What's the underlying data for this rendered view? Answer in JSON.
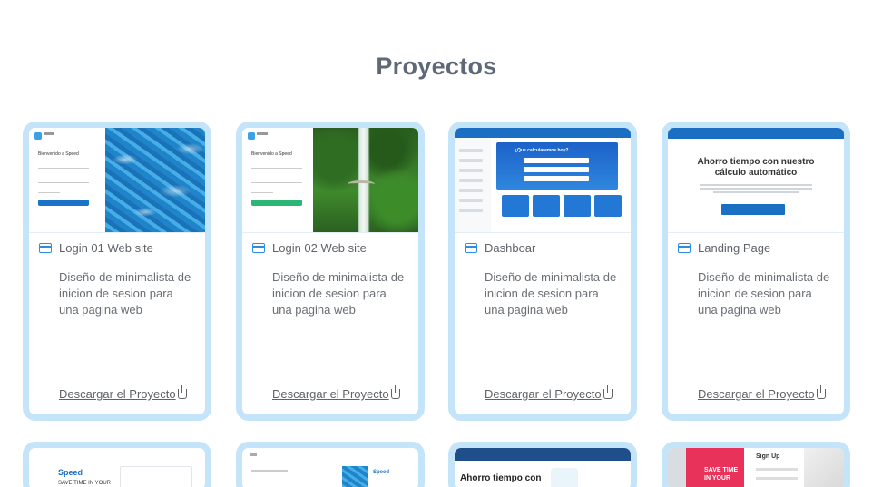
{
  "page": {
    "title": "Proyectos"
  },
  "cards": [
    {
      "title": "Login 01 Web site",
      "desc": "Diseño de minimalista de inicion de sesion para una pagina web",
      "link": "Descargar el Proyecto",
      "thumb": {
        "heading": "Bienvenido a Speed",
        "button_color": "#1a73c9"
      }
    },
    {
      "title": "Login 02 Web site",
      "desc": "Diseño de minimalista de inicion de sesion para una pagina web",
      "link": "Descargar el Proyecto",
      "thumb": {
        "heading": "Bienvenido a Speed",
        "button_color": "#2bb673"
      }
    },
    {
      "title": "Dashboar",
      "desc": "Diseño de minimalista de inicion de sesion para una pagina web",
      "link": "Descargar el Proyecto",
      "thumb": {
        "heading": "¿Que calcularemos hoy?"
      }
    },
    {
      "title": "Landing Page",
      "desc": "Diseño de minimalista de inicion de sesion para una pagina web",
      "link": "Descargar el Proyecto",
      "thumb": {
        "heading": "Ahorro tiempo con nuestro cálculo automático"
      }
    }
  ],
  "bottom_cards": [
    {
      "thumb_heading": "Speed",
      "thumb_sub": "SAVE TIME IN YOUR"
    },
    {
      "thumb_heading": "Speed"
    },
    {
      "thumb_heading": "Ahorro tiempo con"
    },
    {
      "thumb_heading": "Sign Up",
      "thumb_sub": "SAVE TIME IN YOUR"
    }
  ],
  "colors": {
    "accent": "#2e8de0",
    "card_border": "#c4e4fa",
    "title": "#5f6877"
  },
  "icons": {
    "card_icon": "credit-card-icon",
    "download_icon": "download-icon"
  }
}
